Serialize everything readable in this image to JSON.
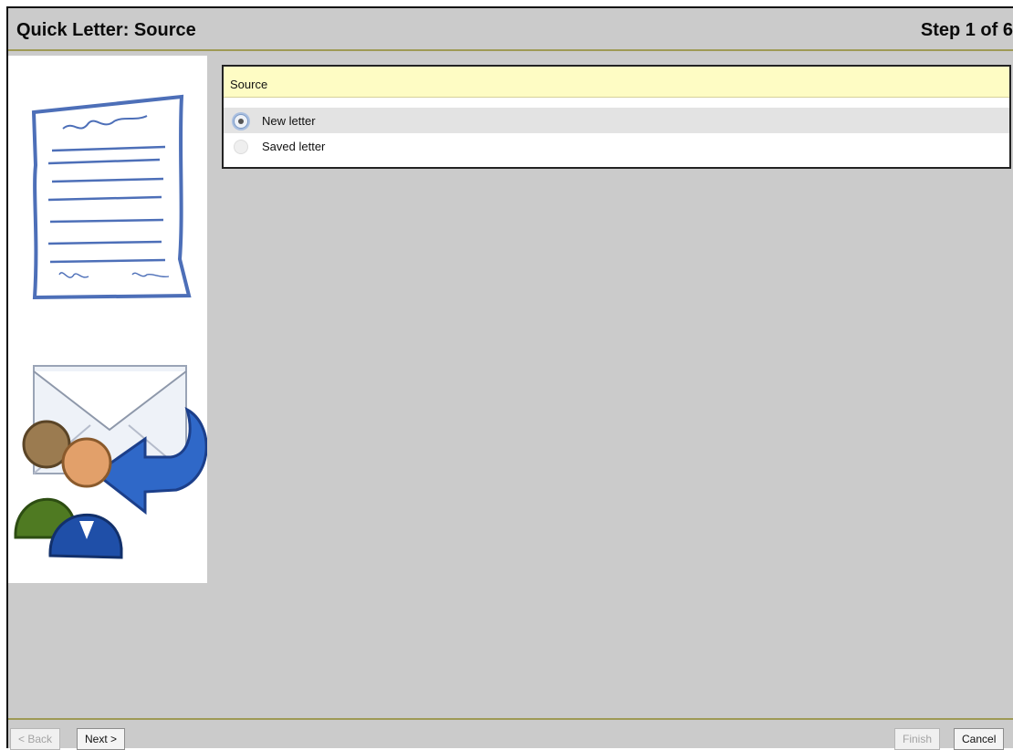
{
  "header": {
    "title": "Quick Letter: Source",
    "step": "Step 1 of 6"
  },
  "sidebar": {
    "illustrations": [
      "letter-document-icon",
      "mail-contacts-icon"
    ]
  },
  "panel": {
    "title": "Source",
    "options": [
      {
        "label": "New letter",
        "selected": true
      },
      {
        "label": "Saved letter",
        "selected": false
      }
    ]
  },
  "footer": {
    "back_label": "< Back",
    "next_label": "Next >",
    "finish_label": "Finish",
    "cancel_label": "Cancel"
  },
  "colors": {
    "background": "#cbcbcb",
    "header_rule": "#9e9a55",
    "panel_header": "#fefcc4",
    "selected_row": "#e3e3e3",
    "illustration_blue": "#3b64b3"
  }
}
